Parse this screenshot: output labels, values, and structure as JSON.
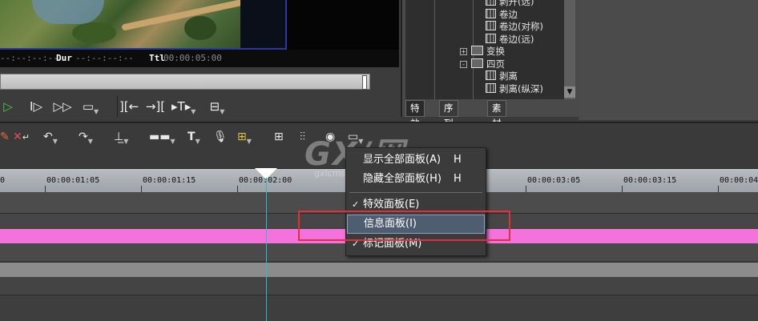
{
  "player": {
    "timecode_in": "--:--:--:--",
    "dur_label": "Dur",
    "dur_value": "--:--:--:--",
    "ttl_label": "Ttl",
    "ttl_value": "00:00:05:00"
  },
  "transport_icons": [
    "play-icon",
    "step-forward-icon",
    "fast-forward-icon",
    "loop-icon",
    "mark-in-icon",
    "mark-out-icon",
    "split-icon",
    "snapshot-icon"
  ],
  "effects_panel": {
    "tree": [
      {
        "label": "剥开(远)",
        "type": "effect",
        "indent": 3
      },
      {
        "label": "卷边",
        "type": "effect",
        "indent": 3
      },
      {
        "label": "卷边(对称)",
        "type": "effect",
        "indent": 3
      },
      {
        "label": "卷边(远)",
        "type": "effect",
        "indent": 3
      },
      {
        "label": "变换",
        "type": "folder",
        "indent": 2,
        "toggle": "+"
      },
      {
        "label": "四页",
        "type": "folder-open",
        "indent": 2,
        "toggle": "-"
      },
      {
        "label": "剥离",
        "type": "effect",
        "indent": 3
      },
      {
        "label": "剥离(纵深)",
        "type": "effect",
        "indent": 3
      }
    ],
    "tabs": [
      "特效",
      "序列标记",
      "素材库"
    ]
  },
  "toolbar": {
    "icons": [
      "delete-ripple-icon",
      "undo-icon",
      "redo-icon",
      "audio-mix-icon",
      "transition-icon",
      "title-icon",
      "voiceover-icon",
      "render-icon",
      "multicam-icon",
      "mixer-icon",
      "color-icon",
      "panel-icon"
    ],
    "title_glyph": "T"
  },
  "ruler": {
    "ticks": [
      "00:00:01:05",
      "00:00:01:15",
      "00:00:02:00",
      "00:00:03:05",
      "00:00:03:15",
      "00:00:04"
    ],
    "leading_tick": "0"
  },
  "context_menu": {
    "items": [
      {
        "label": "显示全部面板(A)",
        "shortcut": "H",
        "checked": false
      },
      {
        "label": "隐藏全部面板(H)",
        "shortcut": "H",
        "checked": false
      },
      {
        "label": "特效面板(E)",
        "shortcut": "",
        "checked": true
      },
      {
        "label": "信息面板(I)",
        "shortcut": "",
        "checked": false,
        "highlighted": true
      },
      {
        "label": "标记面板(M)",
        "shortcut": "",
        "checked": true
      }
    ],
    "check_glyph": "✓"
  },
  "watermark": {
    "text": "GX/网",
    "sub": "gxlcms.com"
  },
  "colors": {
    "accent_track": "#f472dc",
    "playhead": "#38b6c8",
    "highlight_box": "#e0303e",
    "play_green": "#3fd13f"
  }
}
